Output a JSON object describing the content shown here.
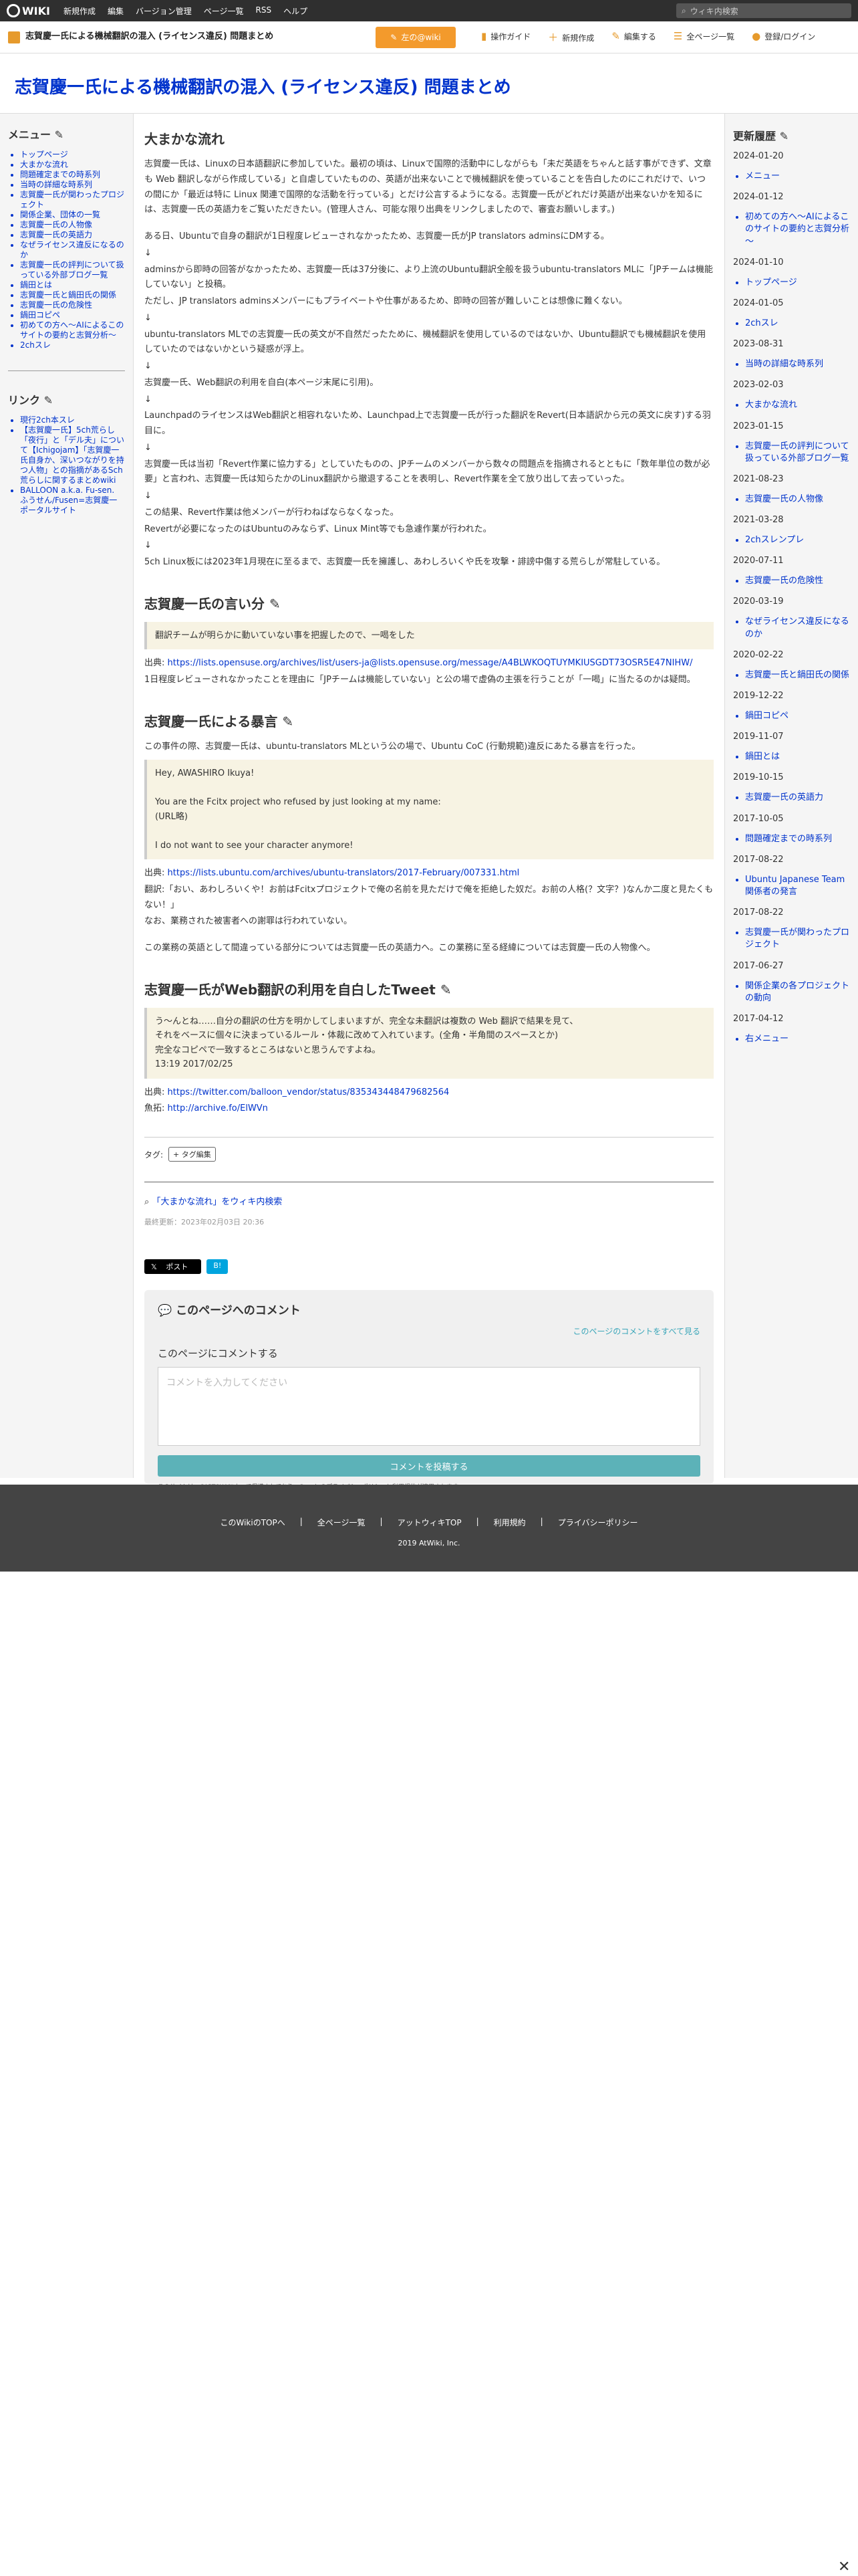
{
  "top": {
    "logo": "WIKI",
    "menu": [
      "新規作成",
      "編集",
      "バージョン管理",
      "ページ一覧",
      "RSS",
      "ヘルプ"
    ],
    "search_placeholder": "ウィキ内検索"
  },
  "sub": {
    "title": "志賀慶一氏による機械翻訳の混入 (ライセンス違反) 問題まとめ",
    "edit": "左の@wiki",
    "acts": [
      "操作ガイド",
      "新規作成",
      "編集する",
      "全ページ一覧",
      "登録/ログイン"
    ]
  },
  "page_title": "志賀慶一氏による機械翻訳の混入 (ライセンス違反) 問題まとめ",
  "menu": {
    "title": "メニュー",
    "items": [
      "トップページ",
      "大まかな流れ",
      "問題確定までの時系列",
      "当時の詳細な時系列",
      "志賀慶一氏が関わったプロジェクト",
      "関係企業、団体の一覧",
      "志賀慶一氏の人物像",
      "志賀慶一氏の英語力",
      "なぜライセンス違反になるのか",
      "志賀慶一氏の評判について扱っている外部ブログ一覧",
      "鍋田とは",
      "志賀慶一氏と鍋田氏の関係",
      "志賀慶一氏の危険性",
      "鍋田コピペ",
      "初めての方へ～AIによるこのサイトの要約と志賀分析～",
      "2chスレ"
    ]
  },
  "links": {
    "title": "リンク",
    "items": [
      "現行2ch本スレ",
      "【志賀慶一氏】5ch荒らし「夜行」と「デル夫」について【Ichigojam】「志賀慶一氏自身か、深いつながりを持つ人物」との指摘があるSch荒らしに関するまとめwiki",
      "BALLOON a.k.a. Fu-sen. ふうせん/Fusen=志賀慶一ポータルサイト"
    ]
  },
  "history": {
    "title": "更新履歴",
    "entries": [
      {
        "date": "2024-01-20",
        "item": "メニュー"
      },
      {
        "date": "2024-01-12",
        "item": "初めての方へ～AIによるこのサイトの要約と志賀分析～"
      },
      {
        "date": "2024-01-10",
        "item": "トップページ"
      },
      {
        "date": "2024-01-05",
        "item": "2chスレ"
      },
      {
        "date": "2023-08-31",
        "item": "当時の詳細な時系列"
      },
      {
        "date": "2023-02-03",
        "item": "大まかな流れ"
      },
      {
        "date": "2023-01-15",
        "item": "志賀慶一氏の評判について扱っている外部ブログ一覧"
      },
      {
        "date": "2021-08-23",
        "item": "志賀慶一氏の人物像"
      },
      {
        "date": "2021-03-28",
        "item": "2chスレンプレ"
      },
      {
        "date": "2020-07-11",
        "item": "志賀慶一氏の危険性"
      },
      {
        "date": "2020-03-19",
        "item": "なぜライセンス違反になるのか"
      },
      {
        "date": "2020-02-22",
        "item": "志賀慶一氏と鍋田氏の関係"
      },
      {
        "date": "2019-12-22",
        "item": "鍋田コピペ"
      },
      {
        "date": "2019-11-07",
        "item": "鍋田とは"
      },
      {
        "date": "2019-10-15",
        "item": "志賀慶一氏の英語力"
      },
      {
        "date": "2017-10-05",
        "item": "問題確定までの時系列"
      },
      {
        "date": "2017-08-22",
        "item": "Ubuntu Japanese Team 関係者の発言"
      },
      {
        "date": "2017-08-22",
        "item2": "志賀慶一氏が関わったプロジェクト"
      },
      {
        "date": "2017-06-27",
        "item": "関係企業の各プロジェクトの動向"
      },
      {
        "date": "2017-04-12",
        "item": "右メニュー"
      }
    ]
  },
  "s1": {
    "h": "大まかな流れ",
    "p1": "志賀慶一氏は、Linuxの日本語翻訳に参加していた。最初の頃は、Linuxで国際的活動中にしながらも「未だ英語をちゃんと話す事ができず、文章も Web 翻訳しながら作成している」と自虐していたものの、英語が出来ないことで機械翻訳を使っていることを告白したのにこれだけで、いつの間にか「最近は特に Linux 関連で国際的な活動を行っている」とだけ公言するようになる。志賀慶一氏がどれだけ英語が出来ないかを知るには、志賀慶一氏の英語力をご覧いただきたい。(管理人さん、可能な限り出典をリンクしましたので、審査お願いします。)",
    "p2": "ある日、Ubuntuで自身の翻訳が1日程度レビューされなかったため、志賀慶一氏がJP translators adminsにDMする。",
    "p3": "adminsから即時の回答がなかったため、志賀慶一氏は37分後に、より上流のUbuntu翻訳全般を扱うubuntu-translators MLに「JPチームは機能していない」と投稿。",
    "p4": "ただし、JP translators adminsメンバーにもプライベートや仕事があるため、即時の回答が難しいことは想像に難くない。",
    "p5": "ubuntu-translators MLでの志賀慶一氏の英文が不自然だったために、機械翻訳を使用しているのではないか、Ubuntu翻訳でも機械翻訳を使用していたのではないかという疑惑が浮上。",
    "p6": "志賀慶一氏、Web翻訳の利用を自白(本ページ末尾に引用)。",
    "p7": "LaunchpadのライセンスはWeb翻訳と相容れないため、Launchpad上で志賀慶一氏が行った翻訳をRevert(日本語訳から元の英文に戻す)する羽目に。",
    "p8": "志賀慶一氏は当初「Revert作業に協力する」としていたものの、JPチームのメンバーから数々の問題点を指摘されるとともに「数年単位の数が必要」と言われ、志賀慶一氏は知らたかのLinux翻訳から撤退することを表明し、Revert作業を全て放り出して去っていった。",
    "p9": "この結果、Revert作業は他メンバーが行わねばならなくなった。",
    "p10": "Revertが必要になったのはUbuntuのみならず、Linux Mint等でも急遽作業が行われた。",
    "p11": "5ch Linux板には2023年1月現在に至るまで、志賀慶一氏を擁護し、あわしろいくや氏を攻撃・誹謗中傷する荒らしが常駐している。"
  },
  "s2": {
    "h": "志賀慶一氏の言い分",
    "quote": "翻訳チームが明らかに動いていない事を把握したので、一喝をした",
    "src_label": "出典:",
    "src": "https://lists.opensuse.org/archives/list/users-ja@lists.opensuse.org/message/A4BLWKOQTUYMKIUSGDT73OSR5E47NIHW/",
    "note": "1日程度レビューされなかったことを理由に「JPチームは機能していない」と公の場で虚偽の主張を行うことが「一喝」に当たるのかは疑問。"
  },
  "s3": {
    "h": "志賀慶一氏による暴言",
    "intro": "この事件の際、志賀慶一氏は、ubuntu-translators MLという公の場で、Ubuntu CoC (行動規範)違反にあたる暴言を行った。",
    "q1": "Hey, AWASHIRO Ikuya!",
    "q2": "You are the Fcitx project who refused by just looking at my name:",
    "q3": "(URL略)",
    "q4": "I do not want to see your character anymore!",
    "src_label": "出典:",
    "src": "https://lists.ubuntu.com/archives/ubuntu-translators/2017-February/007331.html",
    "trans": "翻訳:「おい、あわしろいくや！お前はFcitxプロジェクトで俺の名前を見ただけで俺を拒絶した奴だ。お前の人格(？文字？)なんか二度と見たくもない！」",
    "t2": "なお、業務された被害者への謝罪は行われていない。",
    "t3": "この業務の英語として間違っている部分については志賀慶一氏の英語力へ。この業務に至る経緯については志賀慶一氏の人物像へ。"
  },
  "s4": {
    "h": "志賀慶一氏がWeb翻訳の利用を自白したTweet",
    "q1": "う～んとね……自分の翻訳の仕方を明かしてしまいますが、完全な未翻訳は複数の Web 翻訳で結果を見て、",
    "q2": "それをベースに個々に決まっているルール・体裁に改めて入れています。(全角・半角間のスペースとか)",
    "q3": "完全なコピペで一致するところはないと思うんですよね。",
    "q4": "13:19 2017/02/25",
    "src_label": "出典:",
    "src": "https://twitter.com/balloon_vendor/status/835343448479682564",
    "mirror_label": "魚拓:",
    "mirror": "http://archive.fo/ElWVn"
  },
  "tags": {
    "label": "タグ:",
    "btn": "+ タグ編集"
  },
  "wsearch": "「大まかな流れ」をウィキ内検索",
  "updated": "最終更新：2023年02月03日 20:36",
  "share": {
    "x": "ポスト",
    "b": "B!"
  },
  "comments": {
    "title": "このページへのコメント",
    "all": "このページのコメントをすべて見る",
    "label": "このページにコメントする",
    "placeholder": "コメントを入力してください",
    "submit": "コメントを投稿する",
    "recaptcha": "このサイトはreCAPTCHAによって保護されており、Googleのプライバシーポリシーと利用規約が適用されます。"
  },
  "footer": {
    "links": [
      "このWikiのTOPへ",
      "全ページ一覧",
      "アットウィキTOP",
      "利用規約",
      "プライバシーポリシー"
    ],
    "copy": "2019 AtWiki, Inc."
  }
}
